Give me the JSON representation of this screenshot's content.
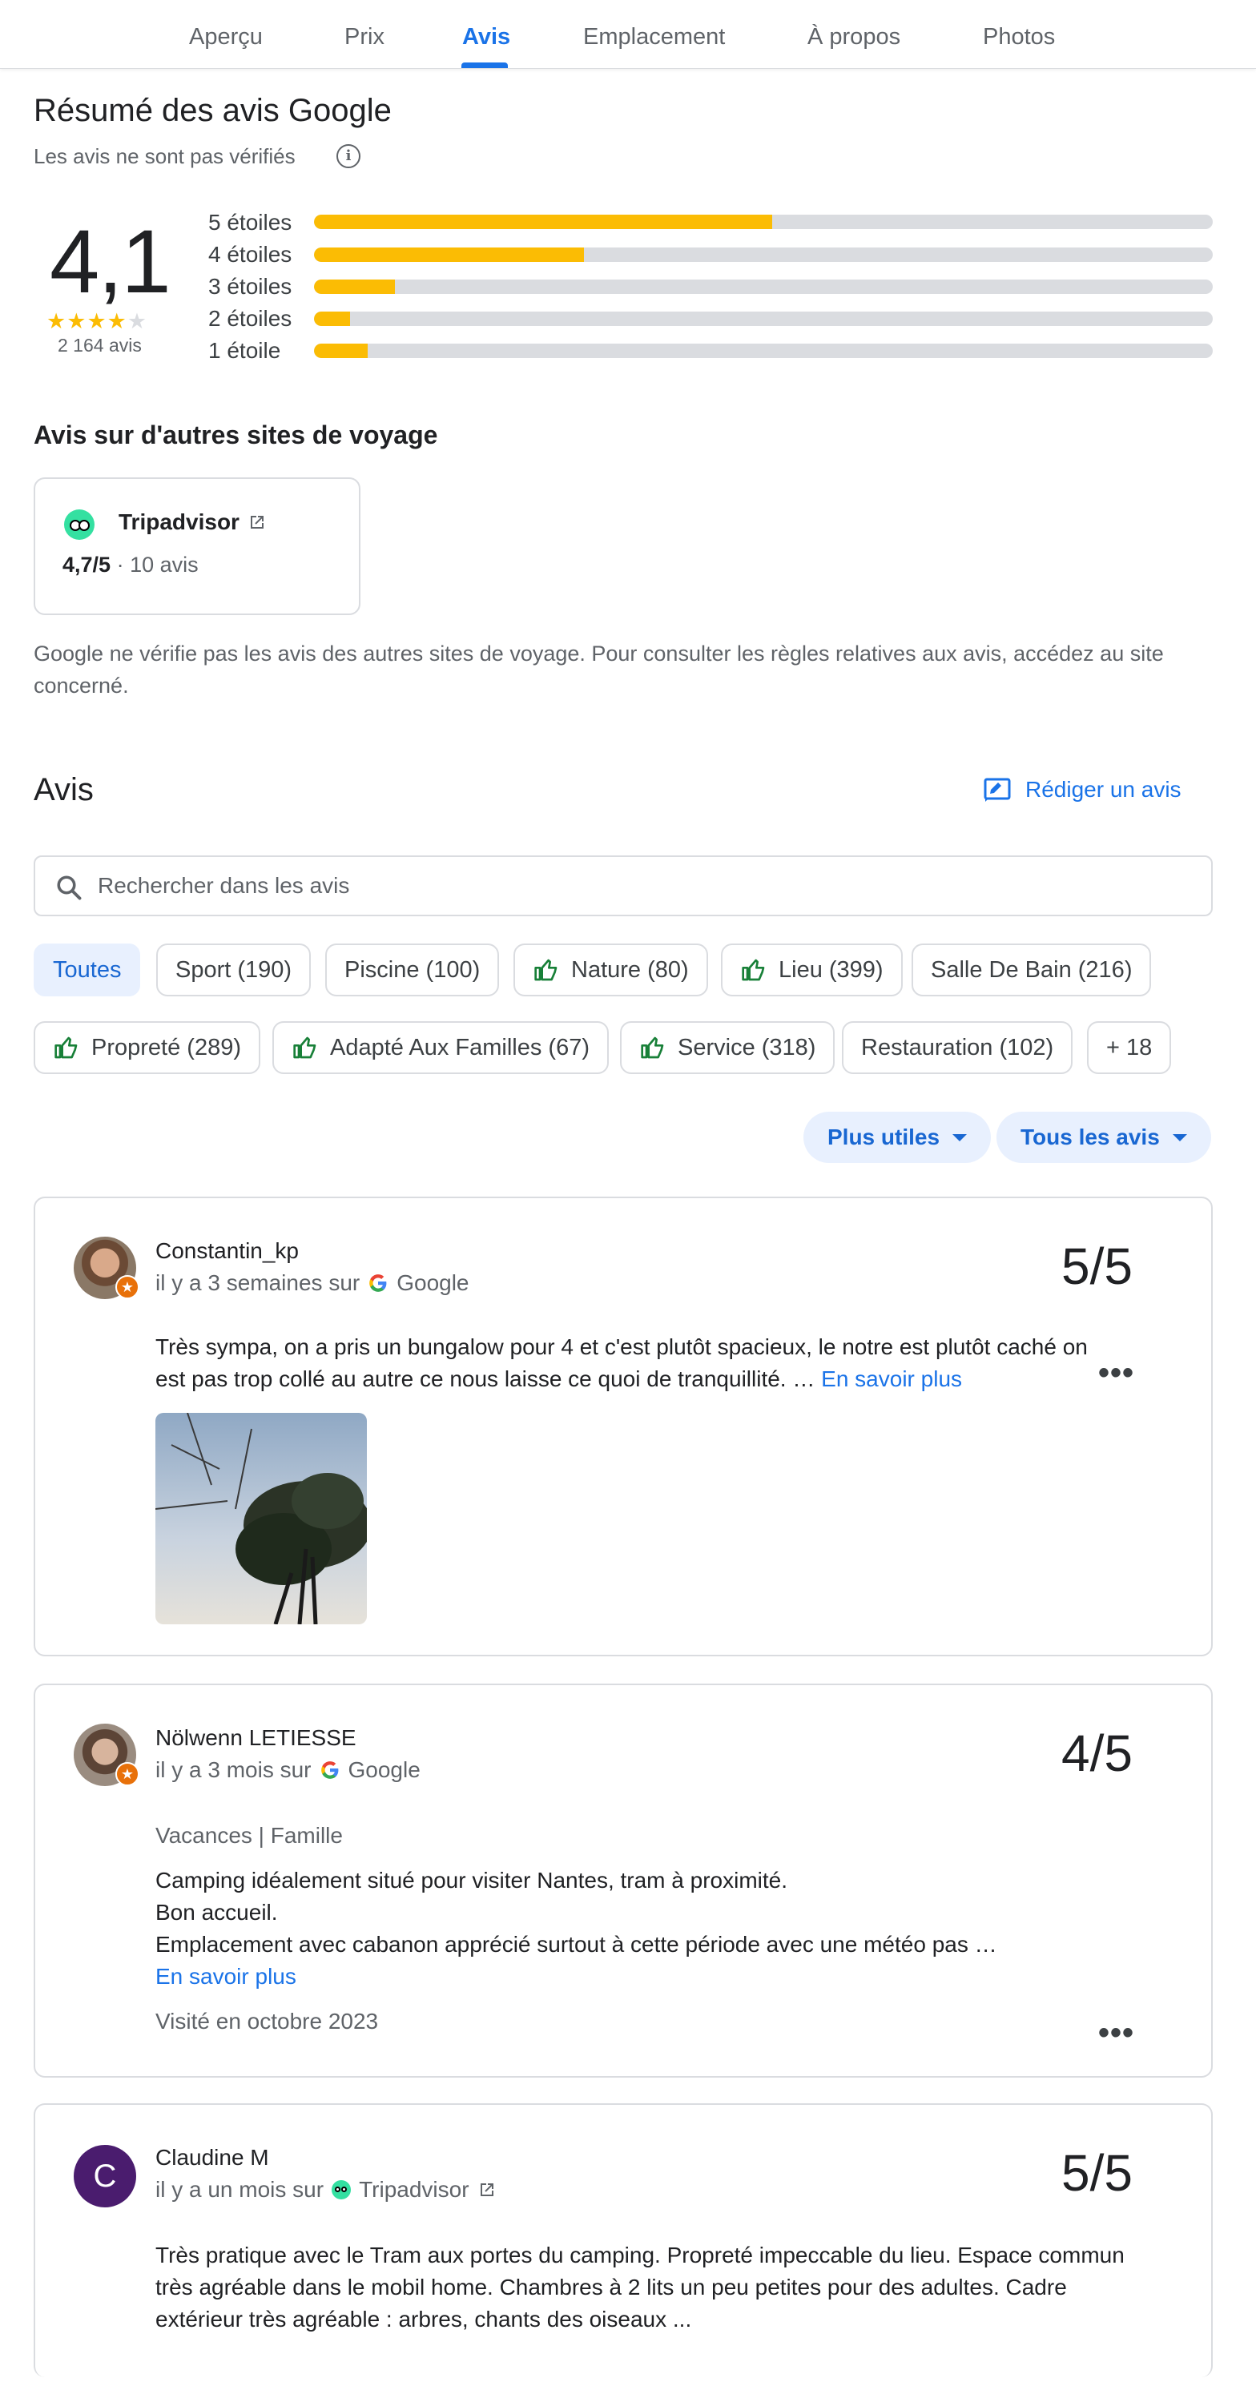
{
  "tabs": [
    {
      "label": "Aperçu"
    },
    {
      "label": "Prix"
    },
    {
      "label": "Avis"
    },
    {
      "label": "Emplacement"
    },
    {
      "label": "À propos"
    },
    {
      "label": "Photos"
    }
  ],
  "summary": {
    "title": "Résumé des avis Google",
    "unverified": "Les avis ne sont pas vérifiés",
    "rating": "4,1",
    "stars": 4.1,
    "count": "2 164 avis",
    "bars": [
      {
        "label": "5 étoiles",
        "fraction": 0.51
      },
      {
        "label": "4 étoiles",
        "fraction": 0.3
      },
      {
        "label": "3 étoiles",
        "fraction": 0.09
      },
      {
        "label": "2 étoiles",
        "fraction": 0.04
      },
      {
        "label": "1 étoile",
        "fraction": 0.06
      }
    ]
  },
  "other_sites": {
    "title": "Avis sur d'autres sites de voyage",
    "card": {
      "name": "Tripadvisor",
      "rating": "4,7/5",
      "separator": "·",
      "count": "10 avis"
    },
    "disclaimer": "Google ne vérifie pas les avis des autres sites de voyage. Pour consulter les règles relatives aux avis, accédez au site concerné."
  },
  "reviews_section": {
    "title": "Avis",
    "write_label": "Rédiger un avis",
    "search_placeholder": "Rechercher dans les avis",
    "chips_row1": [
      {
        "label": "Toutes",
        "thumb": false,
        "selected": true
      },
      {
        "label": "Sport (190)",
        "thumb": false
      },
      {
        "label": "Piscine (100)",
        "thumb": false
      },
      {
        "label": "Nature (80)",
        "thumb": true
      },
      {
        "label": "Lieu (399)",
        "thumb": true
      },
      {
        "label": "Salle De Bain (216)",
        "thumb": false
      }
    ],
    "chips_row2": [
      {
        "label": "Propreté (289)",
        "thumb": true
      },
      {
        "label": "Adapté Aux Familles (67)",
        "thumb": true
      },
      {
        "label": "Service (318)",
        "thumb": true
      },
      {
        "label": "Restauration (102)",
        "thumb": false
      },
      {
        "label": "+ 18",
        "thumb": false
      }
    ],
    "sort_label": "Plus utiles",
    "filter_label": "Tous les avis"
  },
  "reviews": [
    {
      "name": "Constantin_kp",
      "when": "il y a 3 semaines sur",
      "source": "Google",
      "score": "5/5",
      "text": "Très sympa, on a pris un bungalow pour 4 et c'est plutôt spacieux, le notre est plutôt caché on est pas trop collé au autre ce nous laisse ce quoi de tranquillité. …",
      "more": "En savoir plus"
    },
    {
      "name": "Nölwenn LETIESSE",
      "when": "il y a 3 mois sur",
      "source": "Google",
      "score": "4/5",
      "trip": "Vacances | Famille",
      "line1": "Camping idéalement situé pour visiter Nantes, tram à proximité.",
      "line2": "Bon accueil.",
      "line3": "Emplacement avec cabanon apprécié surtout à cette période avec une météo pas …",
      "more": "En savoir plus",
      "visited": "Visité en octobre 2023"
    },
    {
      "name": "Claudine M",
      "initial": "C",
      "when": "il y a un mois sur",
      "source": "Tripadvisor",
      "score": "5/5",
      "text": "Très pratique avec le Tram aux portes du camping. Propreté impeccable du lieu. Espace commun très agréable dans le mobil home. Chambres à 2 lits un peu petites pour des adultes. Cadre extérieur très agréable : arbres, chants des oiseaux ..."
    }
  ],
  "colors": {
    "accent": "#1a73e8",
    "star": "#fbbc04",
    "tripadvisor": "#34e0a1",
    "avatar_claudine": "#4a1c6e"
  }
}
